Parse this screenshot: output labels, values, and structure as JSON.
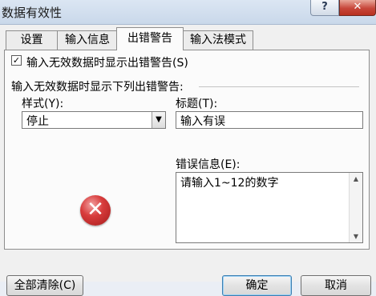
{
  "window": {
    "title": "数据有效性",
    "help_glyph": "?",
    "close_glyph": "✕"
  },
  "tabs": [
    {
      "label": "设置"
    },
    {
      "label": "输入信息"
    },
    {
      "label": "出错警告",
      "active": true
    },
    {
      "label": "输入法模式"
    }
  ],
  "panel": {
    "show_error_checkbox": {
      "label": "输入无效数据时显示出错警告(S)",
      "checked": true
    },
    "group_label": "输入无效数据时显示下列出错警告:",
    "style_label": "样式(Y):",
    "style_value": "停止",
    "title_label": "标题(T):",
    "title_value": "输入有误",
    "message_label": "错误信息(E):",
    "message_value": "请输入1~12的数字",
    "icon": "error-stop-icon"
  },
  "buttons": {
    "clear_all": "全部清除(C)",
    "ok": "确定",
    "cancel": "取消"
  }
}
